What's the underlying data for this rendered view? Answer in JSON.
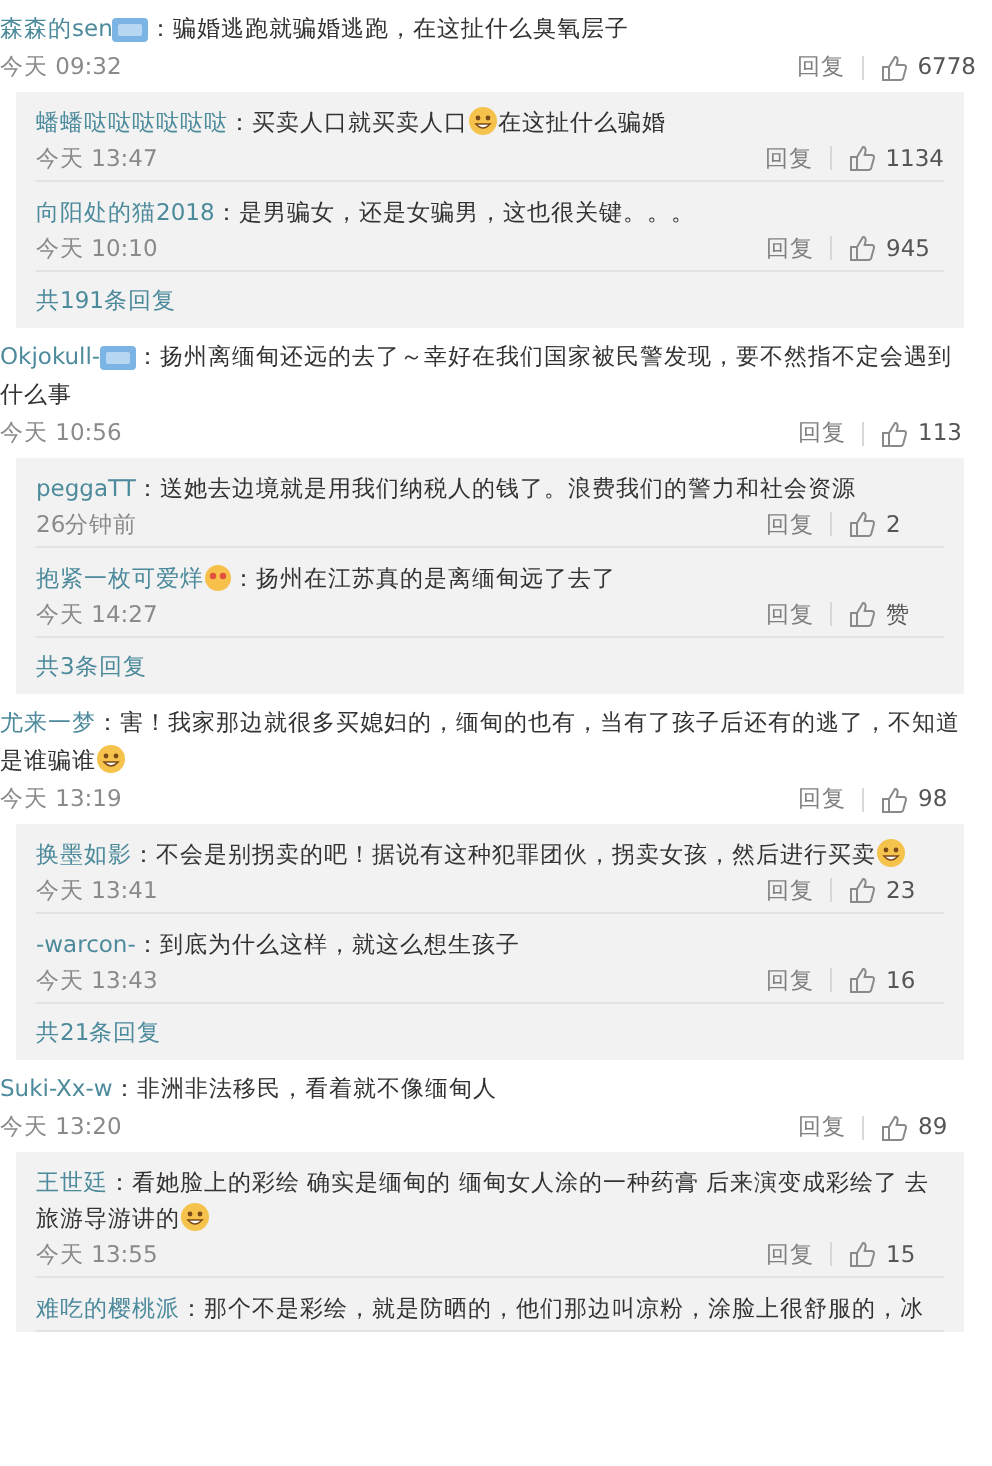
{
  "comments": [
    {
      "user": "森森的sen",
      "badge": {
        "kind": "level"
      },
      "content": [
        {
          "kind": "text",
          "value": "：骗婚逃跑就骗婚逃跑，在这扯什么臭氧层子"
        }
      ],
      "time": "今天 09:32",
      "reply_label": "回复",
      "likes": "6778",
      "replies": [
        {
          "user": "蟠蟠哒哒哒哒哒哒",
          "content": [
            {
              "kind": "text",
              "value": "：买卖人口就买卖人口"
            },
            {
              "kind": "emoji"
            },
            {
              "kind": "text",
              "value": "在这扯什么骗婚"
            }
          ],
          "time": "今天 13:47",
          "reply_label": "回复",
          "likes": "1134"
        },
        {
          "user": "向阳处的猫2018",
          "content": [
            {
              "kind": "text",
              "value": "：是男骗女，还是女骗男，这也很关键。。。"
            }
          ],
          "time": "今天 10:10",
          "reply_label": "回复",
          "likes": "945"
        }
      ],
      "more_replies": "共191条回复"
    },
    {
      "user": "Okjokull-",
      "badge": {
        "kind": "level"
      },
      "content": [
        {
          "kind": "text",
          "value": "：扬州离缅甸还远的去了～幸好在我们国家被民警发现，要不然指不定会遇到什么事"
        }
      ],
      "time": "今天 10:56",
      "reply_label": "回复",
      "likes": "113",
      "replies": [
        {
          "user": "peggaTT",
          "content": [
            {
              "kind": "text",
              "value": "：送她去边境就是用我们纳税人的钱了。浪费我们的警力和社会资源"
            }
          ],
          "time": "26分钟前",
          "reply_label": "回复",
          "likes": "2"
        },
        {
          "user": "抱紧一枚可爱烊",
          "badge": {
            "kind": "emoji"
          },
          "content": [
            {
              "kind": "text",
              "value": "：扬州在江苏真的是离缅甸远了去了"
            }
          ],
          "time": "今天 14:27",
          "reply_label": "回复",
          "likes": "赞"
        }
      ],
      "more_replies": "共3条回复"
    },
    {
      "user": "尤来一梦",
      "content": [
        {
          "kind": "text",
          "value": "：害！我家那边就很多买媳妇的，缅甸的也有，当有了孩子后还有的逃了，不知道是谁骗谁"
        },
        {
          "kind": "emoji"
        }
      ],
      "time": "今天 13:19",
      "reply_label": "回复",
      "likes": "98",
      "replies": [
        {
          "user": "换墨如影",
          "content": [
            {
              "kind": "text",
              "value": "：不会是别拐卖的吧！据说有这种犯罪团伙，拐卖女孩，然后进行买卖"
            },
            {
              "kind": "emoji"
            }
          ],
          "time": "今天 13:41",
          "reply_label": "回复",
          "likes": "23"
        },
        {
          "user": "-warcon-",
          "content": [
            {
              "kind": "text",
              "value": "：到底为什么这样，就这么想生孩子"
            }
          ],
          "time": "今天 13:43",
          "reply_label": "回复",
          "likes": "16"
        }
      ],
      "more_replies": "共21条回复"
    },
    {
      "user": "Suki-Xx-w",
      "content": [
        {
          "kind": "text",
          "value": "：非洲非法移民，看着就不像缅甸人"
        }
      ],
      "time": "今天 13:20",
      "reply_label": "回复",
      "likes": "89",
      "replies": [
        {
          "user": "王世廷",
          "content": [
            {
              "kind": "text",
              "value": "：看她脸上的彩绘 确实是缅甸的 缅甸女人涂的一种药膏 后来演变成彩绘了 去旅游导游讲的"
            },
            {
              "kind": "emoji"
            }
          ],
          "time": "今天 13:55",
          "reply_label": "回复",
          "likes": "15"
        },
        {
          "user": "难吃的樱桃派",
          "content": [
            {
              "kind": "text",
              "value": "：那个不是彩绘，就是防晒的，他们那边叫凉粉，涂脸上很舒服的，冰"
            }
          ]
        }
      ]
    }
  ]
}
